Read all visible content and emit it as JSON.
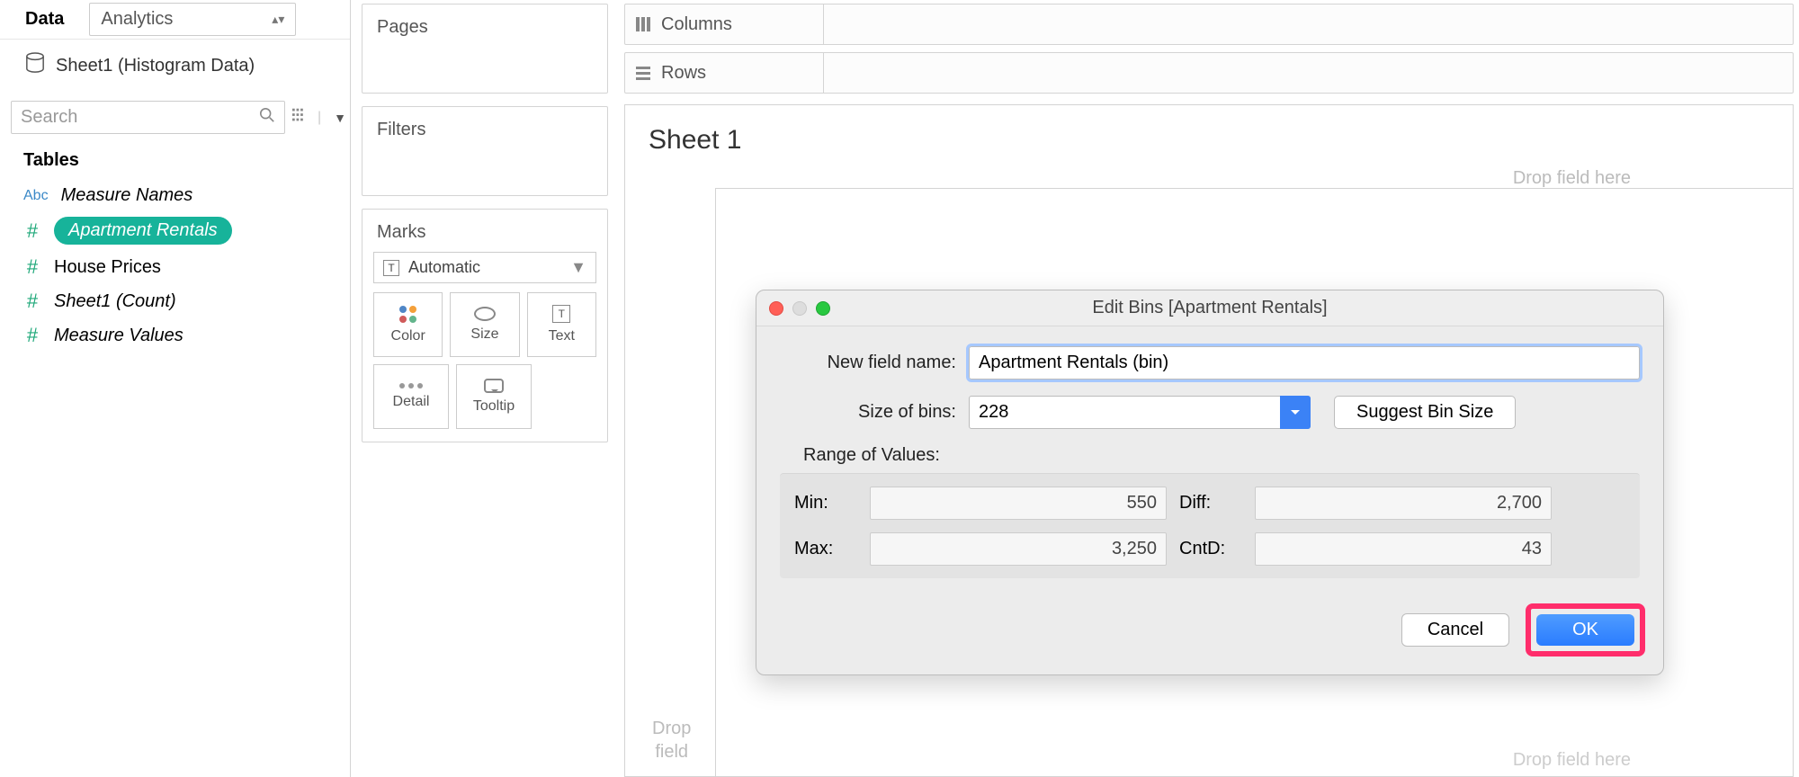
{
  "left": {
    "data_tab": "Data",
    "analytics_tab": "Analytics",
    "datasource": "Sheet1 (Histogram Data)",
    "search_placeholder": "Search",
    "tables_heading": "Tables",
    "fields": [
      {
        "type": "Abc",
        "label": "Measure Names",
        "italic": true
      },
      {
        "type": "#",
        "label": "Apartment Rentals",
        "selected": true
      },
      {
        "type": "#",
        "label": "House Prices"
      },
      {
        "type": "#",
        "label": "Sheet1 (Count)",
        "italic": true
      },
      {
        "type": "#",
        "label": "Measure Values",
        "italic": true
      }
    ]
  },
  "shelves": {
    "pages": "Pages",
    "filters": "Filters",
    "marks": "Marks",
    "mark_type": "Automatic",
    "btns": {
      "color": "Color",
      "size": "Size",
      "text": "Text",
      "detail": "Detail",
      "tooltip": "Tooltip"
    }
  },
  "bars": {
    "columns": "Columns",
    "rows": "Rows"
  },
  "canvas": {
    "title": "Sheet 1",
    "drop_here": "Drop field here",
    "drop": "Drop",
    "field": "field"
  },
  "dialog": {
    "title": "Edit Bins [Apartment Rentals]",
    "new_field_label": "New field name:",
    "new_field_value": "Apartment Rentals (bin)",
    "size_label": "Size of bins:",
    "size_value": "228",
    "suggest": "Suggest Bin Size",
    "range_label": "Range of Values:",
    "min_k": "Min:",
    "min_v": "550",
    "max_k": "Max:",
    "max_v": "3,250",
    "diff_k": "Diff:",
    "diff_v": "2,700",
    "cnt_k": "CntD:",
    "cnt_v": "43",
    "cancel": "Cancel",
    "ok": "OK"
  }
}
